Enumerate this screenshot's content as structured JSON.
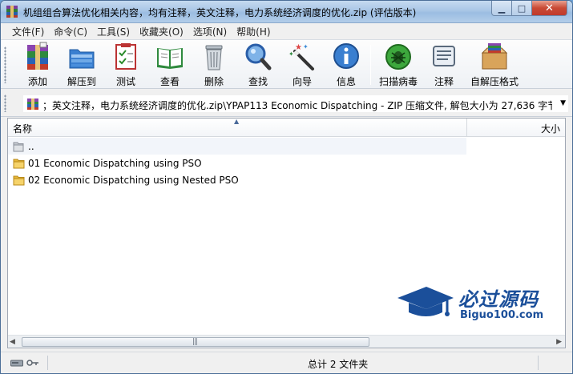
{
  "window": {
    "title": "机组组合算法优化相关内容，均有注释，英文注释，电力系统经济调度的优化.zip (评估版本)"
  },
  "menu": [
    "文件(F)",
    "命令(C)",
    "工具(S)",
    "收藏夹(O)",
    "选项(N)",
    "帮助(H)"
  ],
  "toolbar": {
    "add": "添加",
    "extract": "解压到",
    "test": "测试",
    "view": "查看",
    "delete": "删除",
    "find": "查找",
    "wizard": "向导",
    "info": "信息",
    "scan": "扫描病毒",
    "comment": "注释",
    "sfx": "自解压格式"
  },
  "address": {
    "path": "；英文注释，电力系统经济调度的优化.zip\\YPAP113 Economic Dispatching - ZIP 压缩文件, 解包大小为 27,636 字节"
  },
  "columns": {
    "name": "名称",
    "size": "大小"
  },
  "files": [
    {
      "name": ".."
    },
    {
      "name": "01 Economic Dispatching using PSO"
    },
    {
      "name": "02 Economic Dispatching using Nested PSO"
    }
  ],
  "status": {
    "text": "总计 2 文件夹"
  },
  "watermark": {
    "title": "必过源码",
    "subtitle": "Biguo100.com"
  },
  "colors": {
    "folder": "#e8b838",
    "brand_blue": "#1b4f9a"
  }
}
